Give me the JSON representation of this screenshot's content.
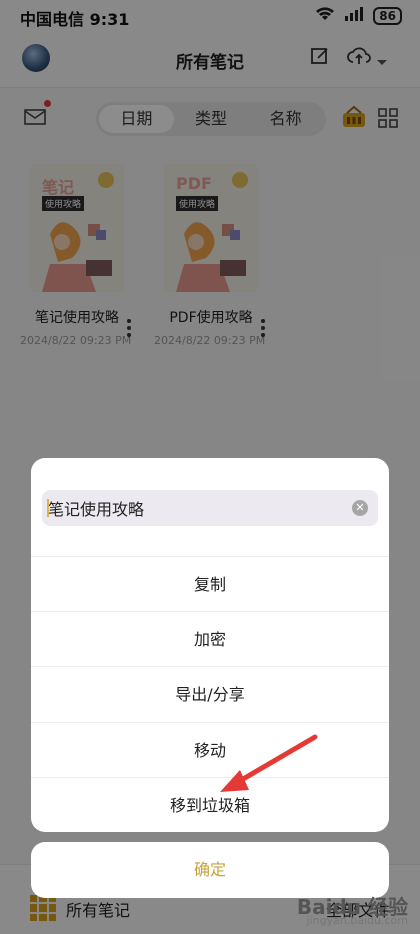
{
  "status": {
    "carrier_time": "中国电信 9:31",
    "battery": "86"
  },
  "header": {
    "title": "所有笔记"
  },
  "tabs": [
    {
      "label": "日期"
    },
    {
      "label": "类型"
    },
    {
      "label": "名称"
    }
  ],
  "notes": [
    {
      "title": "笔记使用攻略",
      "date": "2024/8/22 09:23 PM",
      "cover_title": "笔记",
      "cover_sub": "使用攻略"
    },
    {
      "title": "PDF使用攻略",
      "date": "2024/8/22 09:23 PM",
      "cover_title": "PDF",
      "cover_sub": "使用攻略"
    }
  ],
  "bottom": {
    "label": "所有笔记",
    "right": "全部文件"
  },
  "sheet": {
    "rename_value": "笔记使用攻略",
    "options": [
      {
        "label": "复制"
      },
      {
        "label": "加密"
      },
      {
        "label": "导出/分享"
      },
      {
        "label": "移动"
      },
      {
        "label": "移到垃圾箱"
      }
    ],
    "confirm": "确定"
  },
  "watermark": {
    "brand": "Baidu 经验",
    "url": "jingyan.baidu.com"
  },
  "colors": {
    "accent": "#c8a23b",
    "arrow": "#e53935"
  }
}
